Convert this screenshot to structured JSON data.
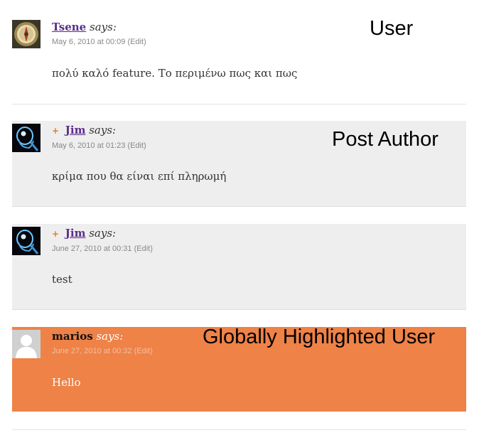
{
  "comments": [
    {
      "author": "Tsene",
      "says": "says:",
      "date": "May 6, 2010 at 00:09",
      "edit": "(Edit)",
      "text": "πολύ καλό feature. Το περιμένω πως και πως"
    },
    {
      "author_mark": "+",
      "author": "Jim",
      "says": "says:",
      "date": "May 6, 2010 at 01:23",
      "edit": "(Edit)",
      "text": "κρίμα που θα είναι επί πληρωμή"
    },
    {
      "author_mark": "+",
      "author": "Jim",
      "says": "says:",
      "date": "June 27, 2010 at 00:31",
      "edit": "(Edit)",
      "text": "test"
    },
    {
      "author": "marios",
      "says": "says:",
      "date": "June 27, 2010 at 00:32",
      "edit": "(Edit)",
      "text": "Hello"
    }
  ],
  "annotations": {
    "user": "User",
    "post_author": "Post Author",
    "highlighted": "Globally Highlighted User"
  },
  "colors": {
    "author_link": "#5b2c8c",
    "author_bg": "#eeeeee",
    "highlight_bg": "#ee8247",
    "date_text": "#888888"
  },
  "icons": {
    "avatar_tsene": "compass-avatar",
    "avatar_jim": "xray-skull-avatar",
    "avatar_marios": "default-person-avatar",
    "author_mark": "post-author-icon"
  }
}
